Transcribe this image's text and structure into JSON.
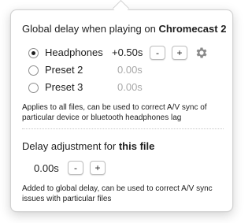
{
  "global": {
    "title_prefix": "Global delay when playing on ",
    "device_name": "Chromecast 2",
    "presets": [
      {
        "label": "Headphones",
        "value": "+0.50s",
        "selected": true
      },
      {
        "label": "Preset 2",
        "value": "0.00s",
        "selected": false
      },
      {
        "label": "Preset 3",
        "value": "0.00s",
        "selected": false
      }
    ],
    "minus_label": "-",
    "plus_label": "+",
    "note": "Applies to all files, can be used to correct A/V sync of particular device or bluetooth headphones lag"
  },
  "file": {
    "title_prefix": "Delay adjustment for ",
    "title_emphasis": "this file",
    "value": "0.00s",
    "minus_label": "-",
    "plus_label": "+",
    "note": "Added to global delay, can be used to correct A/V sync issues with particular files"
  },
  "colors": {
    "dim_value": "#a8a8a8",
    "text": "#1f1f1f",
    "gear": "#8a8a8a"
  },
  "icons": {
    "settings": "gear-icon"
  }
}
